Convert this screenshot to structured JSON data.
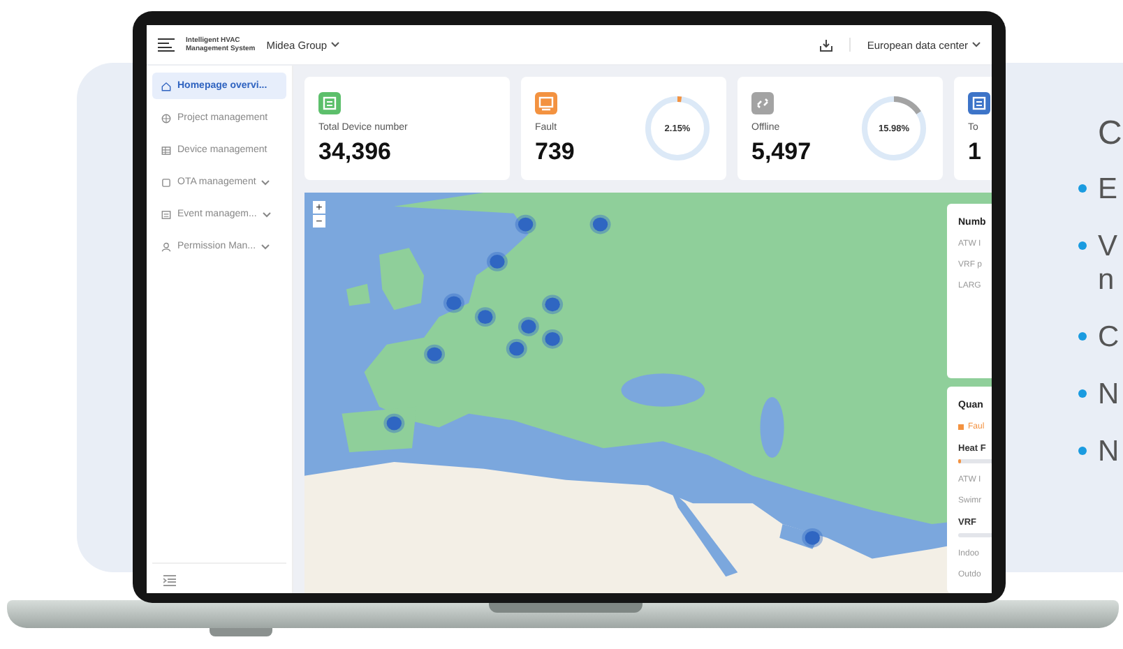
{
  "slide": {
    "heading": "C",
    "bullets": [
      {
        "lines": [
          "E"
        ]
      },
      {
        "lines": [
          "V",
          "n"
        ]
      },
      {
        "lines": [
          "C"
        ]
      },
      {
        "lines": [
          "N"
        ]
      },
      {
        "lines": [
          "N"
        ]
      }
    ]
  },
  "header": {
    "title_lines": [
      "Intelligent HVAC",
      "Management System"
    ],
    "organization": "Midea Group",
    "data_center": "European data center"
  },
  "sidebar": {
    "items": [
      {
        "label": "Homepage overvi...",
        "selected": true,
        "has_submenu": false
      },
      {
        "label": "Project management",
        "selected": false,
        "has_submenu": false
      },
      {
        "label": "Device management",
        "selected": false,
        "has_submenu": false
      },
      {
        "label": "OTA management",
        "selected": false,
        "has_submenu": true
      },
      {
        "label": "Event managem...",
        "selected": false,
        "has_submenu": true
      },
      {
        "label": "Permission Man...",
        "selected": false,
        "has_submenu": true
      }
    ]
  },
  "cards": [
    {
      "label": "Total Device number",
      "value": "34,396",
      "color": "#5cbf6b"
    },
    {
      "label": "Fault",
      "value": "739",
      "color": "#f39240",
      "ring": {
        "reading": "2.15%",
        "level": 0.0215
      }
    },
    {
      "label": "Offline",
      "value": "5,497",
      "color": "#a3a3a3",
      "ring": {
        "reading": "15.98%",
        "level": 0.1598
      }
    },
    {
      "label": "To",
      "value": "1",
      "color": "#3d74c8"
    }
  ],
  "map": {
    "zoom_in": "+",
    "zoom_out": "−"
  },
  "side_panel": {
    "number_card": {
      "title": "Numb",
      "rows": [
        "ATW I",
        "VRF p",
        "LARG"
      ]
    },
    "quantity_card": {
      "title": "Quan",
      "legend": "Faul",
      "groups": [
        {
          "name": "Heat F",
          "level": 0.05,
          "rows": [
            "ATW I",
            "Swimr"
          ]
        },
        {
          "name": "VRF",
          "rows": [
            "Indoo",
            "Outdo"
          ]
        }
      ]
    }
  }
}
